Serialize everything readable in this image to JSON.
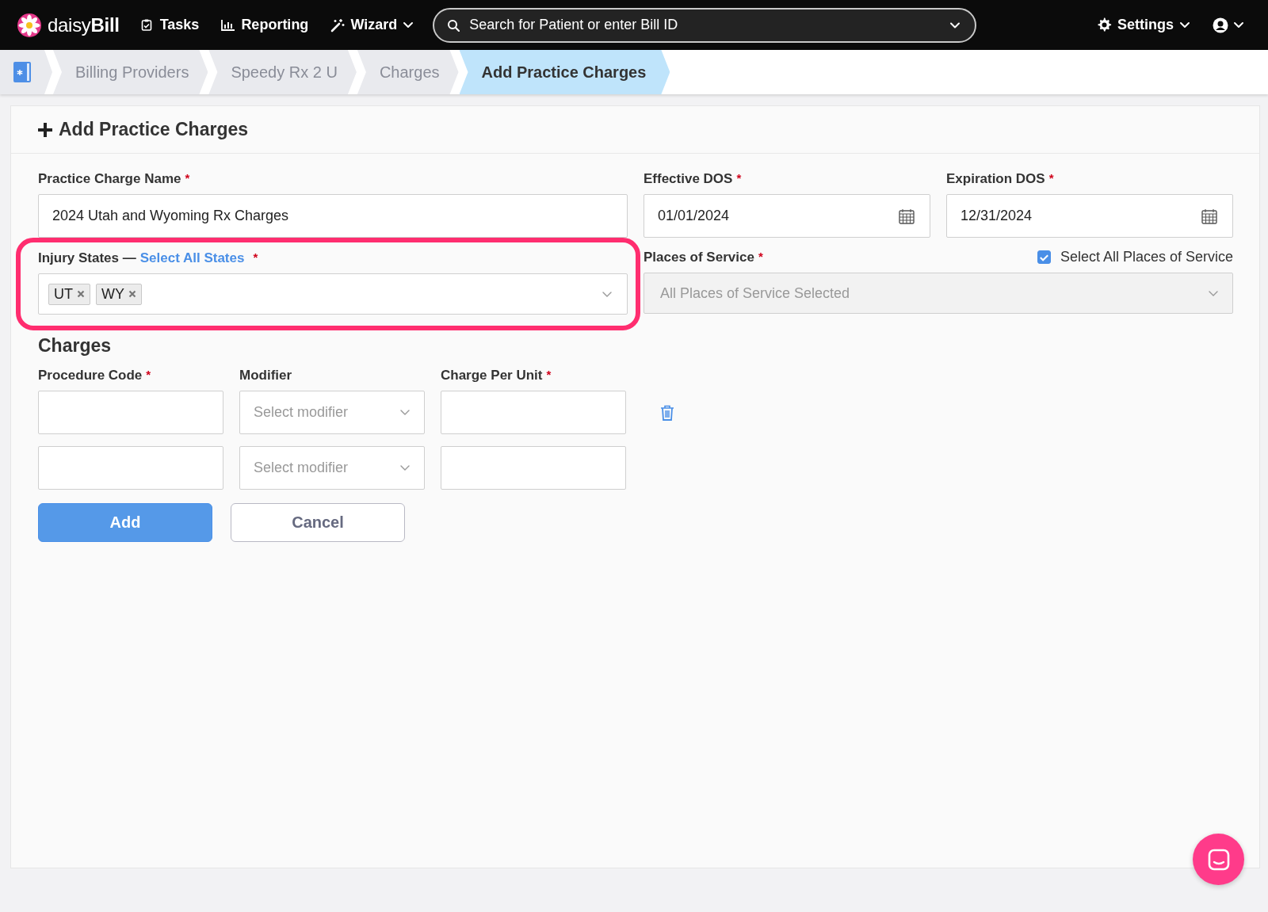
{
  "top_nav": {
    "logo": "daisy**Bill**",
    "items": [
      {
        "label": "Tasks",
        "caret": false
      },
      {
        "label": "Reporting",
        "caret": false
      },
      {
        "label": "Wizard",
        "caret": true
      }
    ],
    "search": {
      "placeholder": "Search for Patient or enter Bill ID"
    },
    "settings": {
      "label": "Settings"
    }
  },
  "breadcrumbs": [
    {
      "label": "Billing Providers",
      "selected": false
    },
    {
      "label": "Speedy Rx 2 U",
      "selected": false
    },
    {
      "label": "Charges",
      "selected": false
    },
    {
      "label": "Add Practice Charges",
      "selected": true
    }
  ],
  "card": {
    "title": "Add Practice Charges",
    "practice_charge_name": {
      "label": "Practice Charge Name",
      "mark": "*",
      "value": "2024 Utah and Wyoming Rx Charges"
    },
    "effective_dos": {
      "label": "Effective DOS",
      "mark": "*",
      "value": "01/01/2024"
    },
    "expiration_dos": {
      "label": "Expiration DOS",
      "mark": "*",
      "value": "12/31/2024"
    },
    "injury_states": {
      "label": "Injury States —",
      "link": "Select All States",
      "mark": "*",
      "highlighted": true,
      "tags": [
        {
          "label": "UT"
        },
        {
          "label": "WY"
        }
      ]
    },
    "places_of_service": {
      "label": "Places of Service",
      "mark": "*",
      "select_all": {
        "label": "Select All Places of Service",
        "checked": true
      },
      "value": "All Places of Service Selected",
      "disabled": true
    },
    "charges": {
      "title": "Charges",
      "columns": [
        {
          "label": "Procedure Code",
          "mark": "*"
        },
        {
          "label": "Modifier"
        },
        {
          "label": "Charge Per Unit",
          "mark": "*"
        }
      ],
      "rows": [
        {
          "modifier_placeholder": "Select modifier",
          "deletable": true
        },
        {
          "modifier_placeholder": "Select modifier",
          "deletable": false
        }
      ]
    },
    "buttons": [
      {
        "label": "Add",
        "kind": "primary"
      },
      {
        "label": "Cancel",
        "kind": "secondary"
      }
    ]
  }
}
